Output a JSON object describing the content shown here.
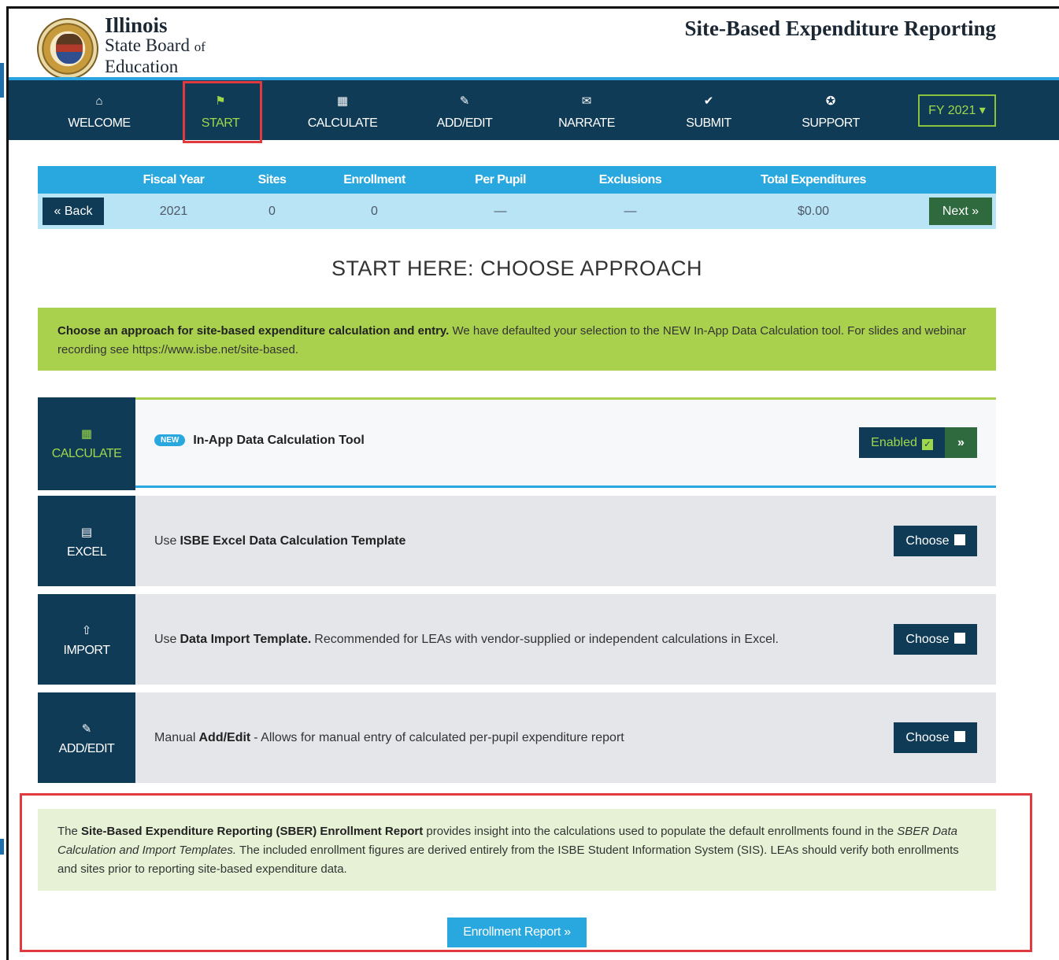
{
  "header": {
    "org_line1": "Illinois",
    "org_line2": "State Board",
    "org_line2_small": "of",
    "org_line3": "Education",
    "app_title": "Site-Based Expenditure Reporting"
  },
  "nav": {
    "items": [
      {
        "label": "WELCOME",
        "icon": "home-icon",
        "glyph": "⌂"
      },
      {
        "label": "START",
        "icon": "flag-icon",
        "glyph": "⚑"
      },
      {
        "label": "CALCULATE",
        "icon": "calculator-icon",
        "glyph": "▦"
      },
      {
        "label": "ADD/EDIT",
        "icon": "edit-icon",
        "glyph": "✎"
      },
      {
        "label": "NARRATE",
        "icon": "comment-icon",
        "glyph": "✉"
      },
      {
        "label": "SUBMIT",
        "icon": "check-circle-icon",
        "glyph": "✔"
      },
      {
        "label": "SUPPORT",
        "icon": "lifering-icon",
        "glyph": "✪"
      }
    ],
    "active": "START",
    "fy_label": "FY 2021 ▾"
  },
  "summary": {
    "headers": [
      "Fiscal Year",
      "Sites",
      "Enrollment",
      "Per Pupil",
      "Exclusions",
      "Total Expenditures"
    ],
    "values": [
      "2021",
      "0",
      "0",
      "—",
      "—",
      "$0.00"
    ],
    "back_label": "« Back",
    "next_label": "Next »"
  },
  "page_heading": "START HERE: CHOOSE APPROACH",
  "notice": {
    "bold": "Choose an approach for site-based expenditure calculation and entry.",
    "text": " We have defaulted your selection to the NEW In-App Data Calculation tool. For slides and webinar recording see https://www.isbe.net/site-based."
  },
  "options": [
    {
      "side_label": "CALCULATE",
      "icon": "calculator-icon",
      "glyph": "▦",
      "badge": "NEW",
      "pre": "",
      "bold": "In-App Data Calculation Tool",
      "post": "",
      "button": "Enabled",
      "status": "enabled"
    },
    {
      "side_label": "EXCEL",
      "icon": "excel-file-icon",
      "glyph": "▤",
      "pre": "Use",
      "bold": "ISBE Excel Data Calculation Template",
      "post": "",
      "button": "Choose",
      "status": "available"
    },
    {
      "side_label": "IMPORT",
      "icon": "upload-icon",
      "glyph": "⇧",
      "pre": "Use",
      "bold": "Data Import Template.",
      "post": "Recommended for LEAs with vendor-supplied or independent calculations in Excel.",
      "button": "Choose",
      "status": "available"
    },
    {
      "side_label": "ADD/EDIT",
      "icon": "edit-icon",
      "glyph": "✎",
      "pre": "Manual",
      "bold": "Add/Edit",
      "post": "- Allows for manual entry of calculated per-pupil expenditure report",
      "button": "Choose",
      "status": "available"
    }
  ],
  "report": {
    "pre": "The ",
    "bold": "Site-Based Expenditure Reporting (SBER) Enrollment Report",
    "mid": " provides insight into the calculations used to populate the default enrollments found in the ",
    "italic": "SBER Data Calculation and Import Templates.",
    "post": " The included enrollment figures are derived entirely from the ISBE Student Information System (SIS). LEAs should verify both enrollments and sites prior to reporting site-based expenditure data.",
    "button": "Enrollment Report »"
  },
  "colors": {
    "navy": "#0f3b57",
    "accent_blue": "#29a8df",
    "accent_green": "#a9d14e",
    "highlight_red": "#e0393e"
  }
}
